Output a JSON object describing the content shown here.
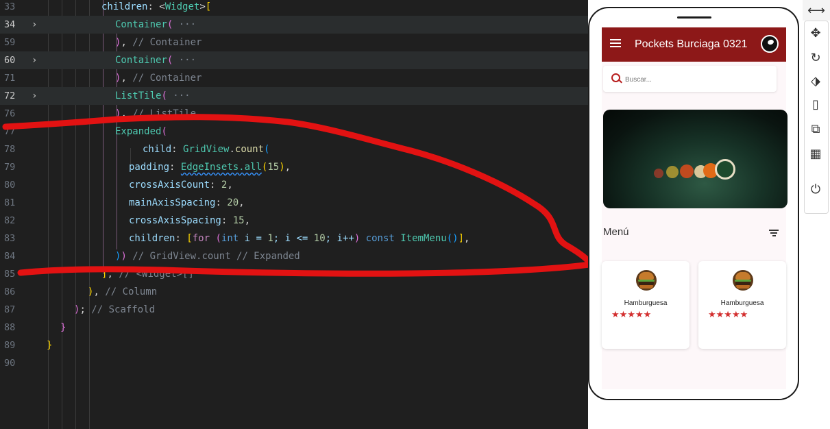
{
  "editor": {
    "lines": [
      {
        "num": "33",
        "fold": "",
        "active": false,
        "hl": false,
        "indent": 148,
        "tokens": [
          [
            "children",
            "t-ident"
          ],
          [
            ": ",
            "t-punc"
          ],
          [
            "<",
            "t-punc"
          ],
          [
            "Widget",
            "t-class"
          ],
          [
            ">",
            "t-punc"
          ],
          [
            "[",
            "t-gold"
          ]
        ]
      },
      {
        "num": "34",
        "fold": "›",
        "active": true,
        "hl": true,
        "indent": 168,
        "tokens": [
          [
            "Container",
            "t-class"
          ],
          [
            "(",
            "t-pink"
          ],
          [
            " ···",
            "t-grey"
          ]
        ]
      },
      {
        "num": "59",
        "fold": "",
        "active": false,
        "hl": false,
        "indent": 168,
        "tokens": [
          [
            ")",
            "t-pink"
          ],
          [
            ", ",
            "t-punc"
          ],
          [
            "// Container",
            "t-grey"
          ]
        ]
      },
      {
        "num": "60",
        "fold": "›",
        "active": true,
        "hl": true,
        "indent": 168,
        "tokens": [
          [
            "Container",
            "t-class"
          ],
          [
            "(",
            "t-pink"
          ],
          [
            " ···",
            "t-grey"
          ]
        ]
      },
      {
        "num": "71",
        "fold": "",
        "active": false,
        "hl": false,
        "indent": 168,
        "tokens": [
          [
            ")",
            "t-pink"
          ],
          [
            ", ",
            "t-punc"
          ],
          [
            "// Container",
            "t-grey"
          ]
        ]
      },
      {
        "num": "72",
        "fold": "›",
        "active": true,
        "hl": true,
        "indent": 168,
        "tokens": [
          [
            "ListTile",
            "t-class"
          ],
          [
            "(",
            "t-pink"
          ],
          [
            " ···",
            "t-grey"
          ]
        ]
      },
      {
        "num": "76",
        "fold": "",
        "active": false,
        "hl": false,
        "indent": 168,
        "tokens": [
          [
            ")",
            "t-pink"
          ],
          [
            ", ",
            "t-punc"
          ],
          [
            "// ListTile",
            "t-grey"
          ]
        ]
      },
      {
        "num": "77",
        "fold": "",
        "active": false,
        "hl": false,
        "indent": 168,
        "tokens": [
          [
            "Expanded",
            "t-class"
          ],
          [
            "(",
            "t-pink"
          ]
        ]
      },
      {
        "num": "78",
        "fold": "",
        "active": false,
        "hl": false,
        "indent": 208,
        "tokens": [
          [
            "child",
            "t-ident"
          ],
          [
            ": ",
            "t-punc"
          ],
          [
            "GridView",
            "t-class"
          ],
          [
            ".",
            "t-punc"
          ],
          [
            "count",
            "t-func"
          ],
          [
            "(",
            "t-blue"
          ]
        ]
      },
      {
        "num": "79",
        "fold": "",
        "active": false,
        "hl": false,
        "indent": 188,
        "tokens": [
          [
            "padding",
            "t-ident"
          ],
          [
            ": ",
            "t-punc"
          ],
          [
            "EdgeInsets.all",
            "t-class squig"
          ],
          [
            "(",
            "t-gold"
          ],
          [
            "15",
            "t-num"
          ],
          [
            ")",
            "t-gold"
          ],
          [
            ",",
            "t-punc"
          ]
        ]
      },
      {
        "num": "80",
        "fold": "",
        "active": false,
        "hl": false,
        "indent": 188,
        "tokens": [
          [
            "crossAxisCount",
            "t-ident"
          ],
          [
            ": ",
            "t-punc"
          ],
          [
            "2",
            "t-num"
          ],
          [
            ",",
            "t-punc"
          ]
        ]
      },
      {
        "num": "81",
        "fold": "",
        "active": false,
        "hl": false,
        "indent": 188,
        "tokens": [
          [
            "mainAxisSpacing",
            "t-ident"
          ],
          [
            ": ",
            "t-punc"
          ],
          [
            "20",
            "t-num"
          ],
          [
            ",",
            "t-punc"
          ]
        ]
      },
      {
        "num": "82",
        "fold": "",
        "active": false,
        "hl": false,
        "indent": 188,
        "tokens": [
          [
            "crossAxisSpacing",
            "t-ident"
          ],
          [
            ": ",
            "t-punc"
          ],
          [
            "15",
            "t-num"
          ],
          [
            ",",
            "t-punc"
          ]
        ]
      },
      {
        "num": "83",
        "fold": "",
        "active": false,
        "hl": false,
        "indent": 188,
        "tokens": [
          [
            "children",
            "t-ident"
          ],
          [
            ": ",
            "t-punc"
          ],
          [
            "[",
            "t-gold"
          ],
          [
            "for",
            "t-ctrl"
          ],
          [
            " (",
            "t-pink"
          ],
          [
            "int",
            "t-kw"
          ],
          [
            " i = ",
            "t-ident"
          ],
          [
            "1",
            "t-num"
          ],
          [
            "; i <= ",
            "t-ident"
          ],
          [
            "10",
            "t-num"
          ],
          [
            "; i++",
            "t-ident"
          ],
          [
            ") ",
            "t-pink"
          ],
          [
            "const",
            "t-kw"
          ],
          [
            " ",
            "t-punc"
          ],
          [
            "ItemMenu",
            "t-class"
          ],
          [
            "()",
            "t-blue"
          ],
          [
            "]",
            "t-gold"
          ],
          [
            ",",
            "t-punc"
          ]
        ]
      },
      {
        "num": "84",
        "fold": "",
        "active": false,
        "hl": false,
        "indent": 168,
        "tokens": [
          [
            ")",
            "t-blue"
          ],
          [
            ")",
            "t-pink"
          ],
          [
            " // GridView.count // Expanded",
            "t-grey"
          ]
        ]
      },
      {
        "num": "85",
        "fold": "",
        "active": false,
        "hl": false,
        "indent": 148,
        "tokens": [
          [
            "]",
            "t-gold"
          ],
          [
            ", ",
            "t-punc"
          ],
          [
            "// <Widget>[]",
            "t-grey"
          ]
        ]
      },
      {
        "num": "86",
        "fold": "",
        "active": false,
        "hl": false,
        "indent": 128,
        "tokens": [
          [
            ")",
            "t-gold"
          ],
          [
            ", ",
            "t-punc"
          ],
          [
            "// Column",
            "t-grey"
          ]
        ]
      },
      {
        "num": "87",
        "fold": "",
        "active": false,
        "hl": false,
        "indent": 108,
        "tokens": [
          [
            ")",
            "t-pink"
          ],
          [
            "; ",
            "t-punc"
          ],
          [
            "// Scaffold",
            "t-grey"
          ]
        ]
      },
      {
        "num": "88",
        "fold": "",
        "active": false,
        "hl": false,
        "indent": 88,
        "tokens": [
          [
            "}",
            "t-pink"
          ]
        ]
      },
      {
        "num": "89",
        "fold": "",
        "active": false,
        "hl": false,
        "indent": 68,
        "tokens": [
          [
            "}",
            "t-gold"
          ]
        ]
      },
      {
        "num": "90",
        "fold": "",
        "active": false,
        "hl": false,
        "indent": 68,
        "tokens": []
      }
    ]
  },
  "phone": {
    "app_title": "Pockets Burciaga 0321",
    "search_placeholder": "Buscar...",
    "section_title": "Menú",
    "cards": [
      {
        "name": "Hamburguesa",
        "stars": "★★★★★"
      },
      {
        "name": "Hamburguesa",
        "stars": "★★★★★"
      }
    ]
  },
  "colors": {
    "appbar": "#8d1818",
    "accent_red": "#d32f2f",
    "editor_bg": "#1f1f1f",
    "annotation_red": "#e21212"
  },
  "toolbar": {
    "icons": [
      "resize-horizontal-icon",
      "move-icon",
      "rotate-icon",
      "rotate-device-icon",
      "fold-device-icon",
      "external-window-icon",
      "qr-code-icon",
      "power-icon"
    ]
  }
}
